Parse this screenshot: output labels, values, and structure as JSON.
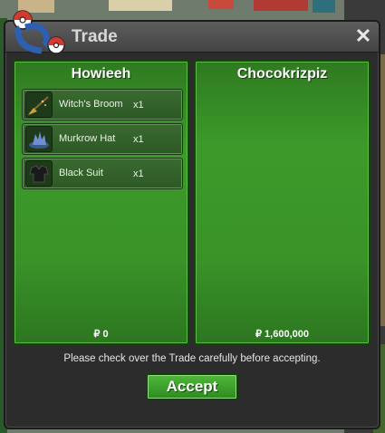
{
  "window": {
    "title": "Trade",
    "close_icon": "close-icon"
  },
  "left_panel": {
    "player_name": "Howieeh",
    "items": [
      {
        "name": "Witch's Broom",
        "qty": "x1",
        "icon": "broom-icon"
      },
      {
        "name": "Murkrow Hat",
        "qty": "x1",
        "icon": "hat-icon"
      },
      {
        "name": "Black Suit",
        "qty": "x1",
        "icon": "suit-icon"
      }
    ],
    "money": "₽ 0"
  },
  "right_panel": {
    "player_name": "Chocokrizpiz",
    "items": [],
    "money": "₽ 1,600,000"
  },
  "notice": "Please check over the Trade carefully before accepting.",
  "accept_label": "Accept",
  "colors": {
    "panel_green": "#3a9328",
    "button_green": "#3fa42d",
    "window_bg": "#2c2c2c"
  }
}
